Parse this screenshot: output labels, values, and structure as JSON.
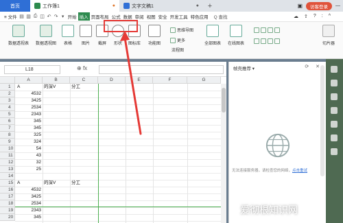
{
  "titlebar": {
    "home": "首页",
    "tab1": "工作簿1",
    "tab2": "文字文稿1",
    "plus": "+",
    "login": "访客登录"
  },
  "menubar": {
    "file": "≡ 文件",
    "items": [
      "开始",
      "插入",
      "页面布局",
      "公式",
      "数据",
      "审阅",
      "视图",
      "安全",
      "开发工具",
      "特色应用"
    ],
    "search": "Q 查找",
    "right_icons": [
      "?",
      ":",
      "^"
    ]
  },
  "ribbon": {
    "buttons": [
      "数据透视表",
      "数据透视图",
      "表格",
      "图片",
      "截屏",
      "形状",
      "图标库",
      "功能图",
      "流程图",
      "全部图表",
      "在线图表",
      "切片器"
    ],
    "small": [
      "思维导图",
      "更多"
    ]
  },
  "formula_bar": {
    "cell_ref": "L18",
    "fx": "fx"
  },
  "columns": [
    "A",
    "B",
    "C",
    "D",
    "E",
    "F",
    "G"
  ],
  "rows": [
    {
      "n": "1",
      "a": "A",
      "b": "的深V",
      "c": "分工"
    },
    {
      "n": "2",
      "a": "4532"
    },
    {
      "n": "3",
      "a": "3425"
    },
    {
      "n": "4",
      "a": "2534"
    },
    {
      "n": "5",
      "a": "2343"
    },
    {
      "n": "6",
      "a": "345"
    },
    {
      "n": "7",
      "a": "345"
    },
    {
      "n": "8",
      "a": "325"
    },
    {
      "n": "9",
      "a": "324"
    },
    {
      "n": "10",
      "a": "54"
    },
    {
      "n": "11",
      "a": "43"
    },
    {
      "n": "12",
      "a": "32"
    },
    {
      "n": "13",
      "a": "25"
    },
    {
      "n": "14",
      "a": ""
    },
    {
      "n": "15",
      "a": "A",
      "b": "的深V",
      "c": "分工"
    },
    {
      "n": "16",
      "a": "4532"
    },
    {
      "n": "17",
      "a": "3425"
    },
    {
      "n": "18",
      "a": "2534"
    },
    {
      "n": "19",
      "a": "2343"
    },
    {
      "n": "20",
      "a": "345"
    }
  ],
  "panel": {
    "title": "帧壳推荐 ▾",
    "controls": "⟳ ✕",
    "message": "无法连接服务器，请检查您的网络，",
    "link": "点击重试"
  },
  "watermark": {
    "text": "爱彻根知识网",
    "url": "www.aichegen.com"
  },
  "colors": {
    "accent": "#2d8a4e",
    "home_tab": "#2f6fd6",
    "highlight": "#e53935"
  }
}
